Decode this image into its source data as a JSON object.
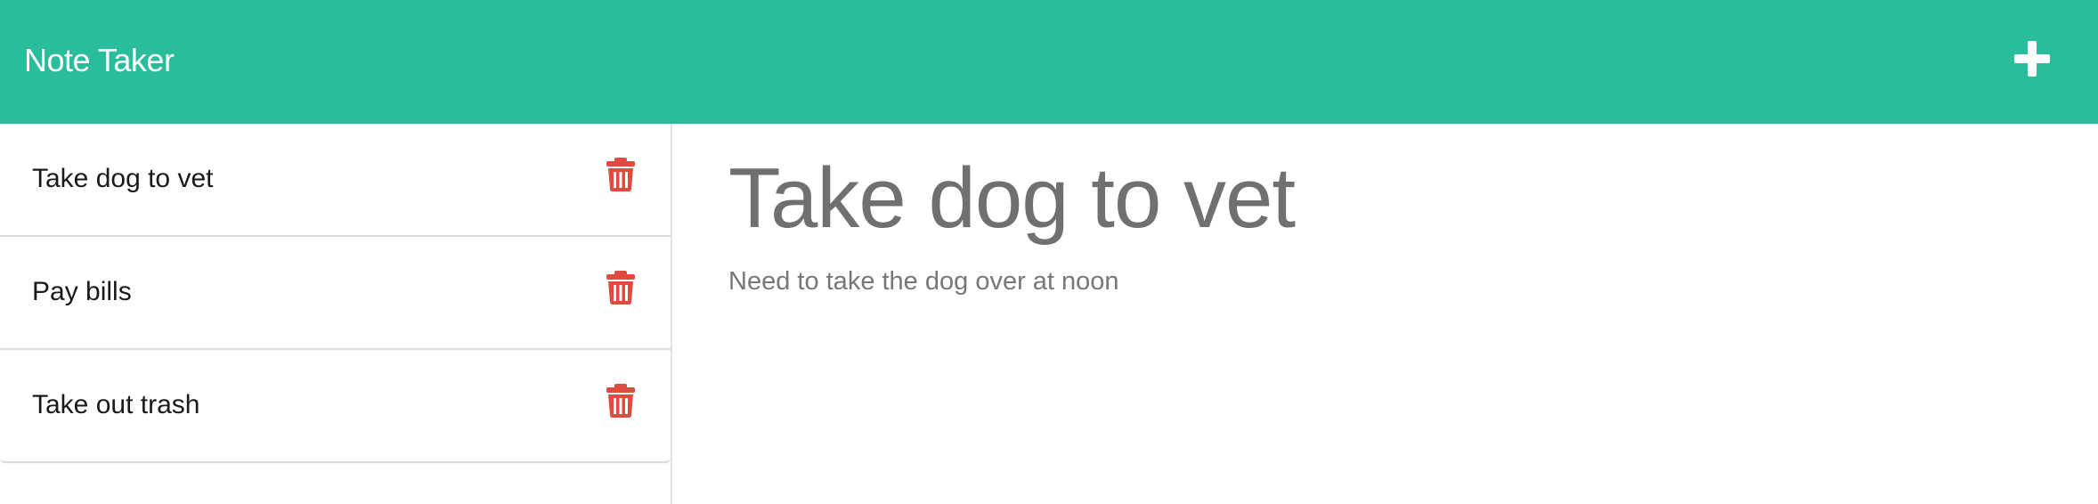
{
  "app": {
    "title": "Note Taker"
  },
  "toolbar": {
    "new_note_icon": "plus-icon"
  },
  "notes": [
    {
      "title": "Take dog to vet",
      "delete_icon": "trash-icon"
    },
    {
      "title": "Pay bills",
      "delete_icon": "trash-icon"
    },
    {
      "title": "Take out trash",
      "delete_icon": "trash-icon"
    }
  ],
  "active_note": {
    "title": "Take dog to vet",
    "text": "Need to take the dog over at noon"
  },
  "colors": {
    "navbar": "#2abd9b",
    "delete_icon": "#e04b3f",
    "title_text": "#707070"
  }
}
